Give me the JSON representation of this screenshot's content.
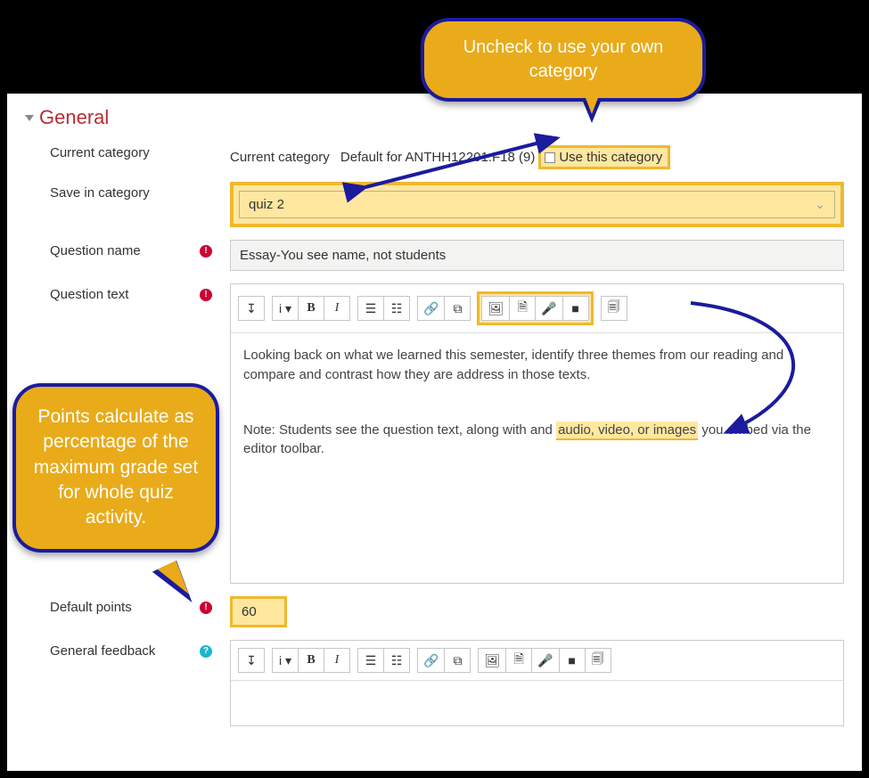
{
  "section": {
    "title": "General"
  },
  "labels": {
    "current_category": "Current category",
    "save_in_category": "Save in category",
    "question_name": "Question name",
    "question_text": "Question text",
    "default_points": "Default points",
    "general_feedback": "General feedback"
  },
  "current_category": {
    "prefix": "Current category",
    "value": "Default for ANTHH12201.F18 (9)",
    "checkbox_label": "Use this category",
    "checked": false
  },
  "save_in_category": {
    "selected": "quiz 2"
  },
  "question_name": {
    "value": "Essay-You see name, not students"
  },
  "question_text": {
    "para1": "Looking back on what we learned this semester, identify three themes from our reading and compare and contrast how they are address in those texts.",
    "para2_pre": "Note:  Students see the question text, along with and ",
    "para2_hl": "audio, video, or images",
    "para2_post": " you embed via the editor toolbar."
  },
  "default_points": {
    "value": "60"
  },
  "toolbar": {
    "expand": "⤢",
    "info": "i",
    "bold": "B",
    "italic": "I",
    "ul": "≡",
    "ol": "≣",
    "link": "🔗",
    "unlink": "✕",
    "image": "🖼",
    "file": "🗎",
    "audio": "🎤",
    "video": "📹",
    "embed": "🗐"
  },
  "callouts": {
    "top": "Uncheck to use your own category",
    "left": "Points calculate as percentage of the maximum grade set for whole quiz activity."
  }
}
